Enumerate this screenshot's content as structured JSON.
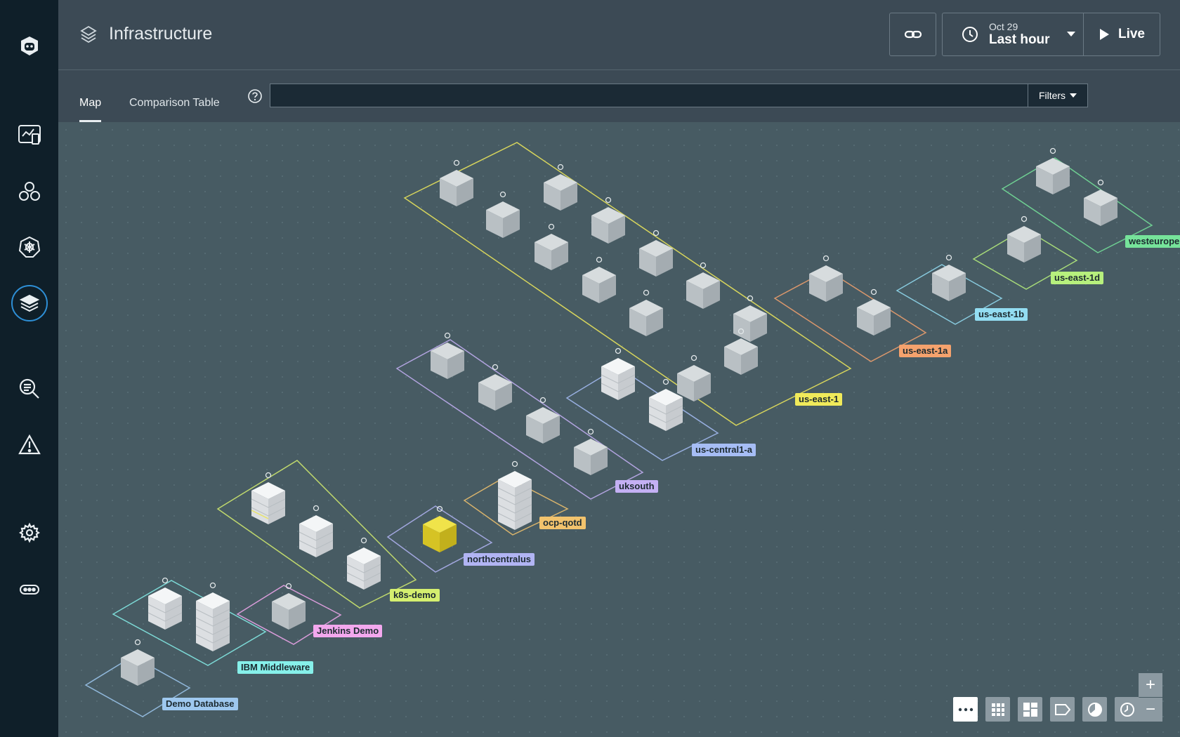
{
  "header": {
    "title": "Infrastructure",
    "time_date": "Oct 29",
    "time_range": "Last hour",
    "live_label": "Live"
  },
  "tabs": [
    {
      "label": "Map",
      "active": true
    },
    {
      "label": "Comparison Table",
      "active": false
    }
  ],
  "search": {
    "value": "",
    "placeholder": ""
  },
  "filters_label": "Filters",
  "sidebar_icons": [
    "logo-icon",
    "dashboard-icon",
    "applications-icon",
    "kubernetes-icon",
    "infrastructure-icon",
    "analytics-icon",
    "events-icon",
    "settings-icon",
    "more-icon"
  ],
  "zones": [
    {
      "name": "Demo Database",
      "color": "#9ec8ef"
    },
    {
      "name": "IBM Middleware",
      "color": "#86f0ea"
    },
    {
      "name": "Jenkins Demo",
      "color": "#f3a8ee"
    },
    {
      "name": "k8s-demo",
      "color": "#d5ef6f"
    },
    {
      "name": "northcentralus",
      "color": "#b1b4f3"
    },
    {
      "name": "ocp-qotd",
      "color": "#f2c36d"
    },
    {
      "name": "uksouth",
      "color": "#c4b0f4"
    },
    {
      "name": "us-central1-a",
      "color": "#a6bdf5"
    },
    {
      "name": "us-east-1",
      "color": "#f0ea5a"
    },
    {
      "name": "us-east-1a",
      "color": "#f5a26d"
    },
    {
      "name": "us-east-1b",
      "color": "#93ddf2"
    },
    {
      "name": "us-east-1d",
      "color": "#b7f07d"
    },
    {
      "name": "westeurope",
      "color": "#76e39a"
    }
  ],
  "view_toolbar": [
    "more-options-icon",
    "grid-icon",
    "layout-icon",
    "tag-icon",
    "pie-icon",
    "clock-icon"
  ],
  "zoom": {
    "in": "+",
    "out": "−"
  }
}
